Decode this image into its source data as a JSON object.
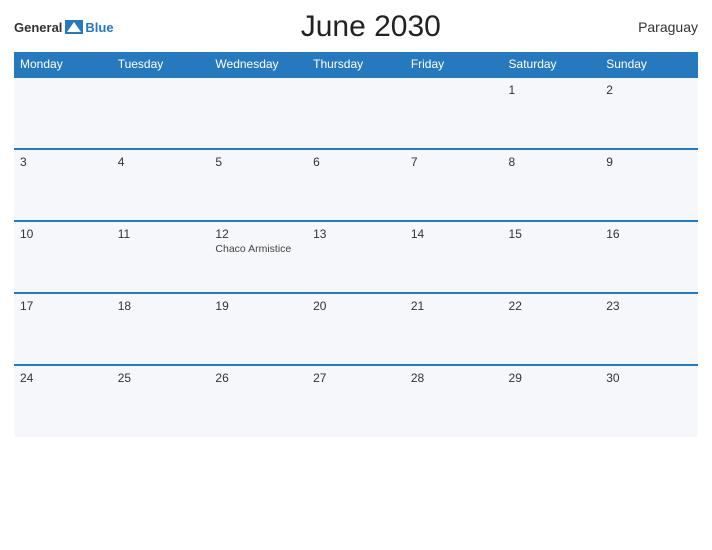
{
  "header": {
    "logo_general": "General",
    "logo_blue": "Blue",
    "title": "June 2030",
    "country": "Paraguay"
  },
  "weekdays": [
    "Monday",
    "Tuesday",
    "Wednesday",
    "Thursday",
    "Friday",
    "Saturday",
    "Sunday"
  ],
  "weeks": [
    [
      {
        "day": "",
        "empty": true
      },
      {
        "day": "",
        "empty": true
      },
      {
        "day": "",
        "empty": true
      },
      {
        "day": "",
        "empty": true
      },
      {
        "day": "",
        "empty": true
      },
      {
        "day": "1",
        "empty": false,
        "event": ""
      },
      {
        "day": "2",
        "empty": false,
        "event": ""
      }
    ],
    [
      {
        "day": "3",
        "empty": false,
        "event": ""
      },
      {
        "day": "4",
        "empty": false,
        "event": ""
      },
      {
        "day": "5",
        "empty": false,
        "event": ""
      },
      {
        "day": "6",
        "empty": false,
        "event": ""
      },
      {
        "day": "7",
        "empty": false,
        "event": ""
      },
      {
        "day": "8",
        "empty": false,
        "event": ""
      },
      {
        "day": "9",
        "empty": false,
        "event": ""
      }
    ],
    [
      {
        "day": "10",
        "empty": false,
        "event": ""
      },
      {
        "day": "11",
        "empty": false,
        "event": ""
      },
      {
        "day": "12",
        "empty": false,
        "event": "Chaco Armistice"
      },
      {
        "day": "13",
        "empty": false,
        "event": ""
      },
      {
        "day": "14",
        "empty": false,
        "event": ""
      },
      {
        "day": "15",
        "empty": false,
        "event": ""
      },
      {
        "day": "16",
        "empty": false,
        "event": ""
      }
    ],
    [
      {
        "day": "17",
        "empty": false,
        "event": ""
      },
      {
        "day": "18",
        "empty": false,
        "event": ""
      },
      {
        "day": "19",
        "empty": false,
        "event": ""
      },
      {
        "day": "20",
        "empty": false,
        "event": ""
      },
      {
        "day": "21",
        "empty": false,
        "event": ""
      },
      {
        "day": "22",
        "empty": false,
        "event": ""
      },
      {
        "day": "23",
        "empty": false,
        "event": ""
      }
    ],
    [
      {
        "day": "24",
        "empty": false,
        "event": ""
      },
      {
        "day": "25",
        "empty": false,
        "event": ""
      },
      {
        "day": "26",
        "empty": false,
        "event": ""
      },
      {
        "day": "27",
        "empty": false,
        "event": ""
      },
      {
        "day": "28",
        "empty": false,
        "event": ""
      },
      {
        "day": "29",
        "empty": false,
        "event": ""
      },
      {
        "day": "30",
        "empty": false,
        "event": ""
      }
    ]
  ]
}
